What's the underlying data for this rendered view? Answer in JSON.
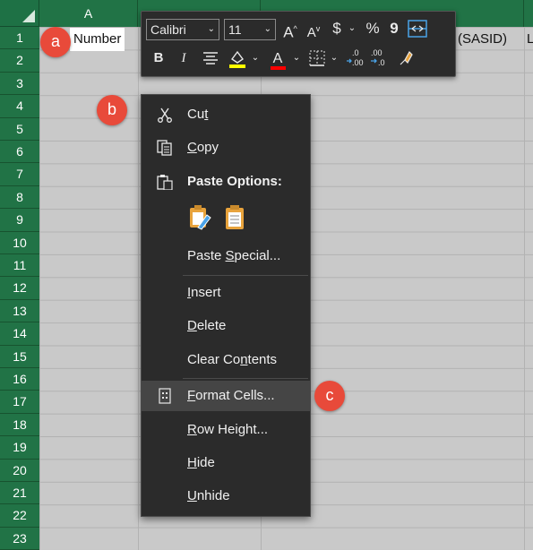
{
  "columns": {
    "a": "A"
  },
  "rows": [
    "1",
    "2",
    "3",
    "4",
    "5",
    "6",
    "7",
    "8",
    "9",
    "10",
    "11",
    "12",
    "13",
    "14",
    "15",
    "16",
    "17",
    "18",
    "19",
    "20",
    "21",
    "22",
    "23"
  ],
  "cells": {
    "a1": "Number",
    "b1_partial": "(SASID)",
    "c1_partial": "L"
  },
  "mini_toolbar": {
    "font_name": "Calibri",
    "font_size": "11",
    "grow_font": "A",
    "shrink_font": "A",
    "currency": "$",
    "percent": "%",
    "comma": "9",
    "bold": "B",
    "italic": "I",
    "font_color": "A",
    "highlight_color": "#ffff00",
    "font_color_swatch": "#ff0000"
  },
  "context_menu": {
    "cut": "Cut",
    "copy": "Copy",
    "paste_options": "Paste Options:",
    "paste_special": "Paste Special...",
    "insert": "Insert",
    "delete": "Delete",
    "clear_contents": "Clear Contents",
    "format_cells": "Format Cells...",
    "row_height": "Row Height...",
    "hide": "Hide",
    "unhide": "Unhide"
  },
  "callouts": {
    "a": "a",
    "b": "b",
    "c": "c"
  },
  "colors": {
    "header_green": "#217346",
    "callout_red": "#e84a3a",
    "menu_bg": "#2b2b2b",
    "paste_icon_orange": "#e8a33c"
  }
}
